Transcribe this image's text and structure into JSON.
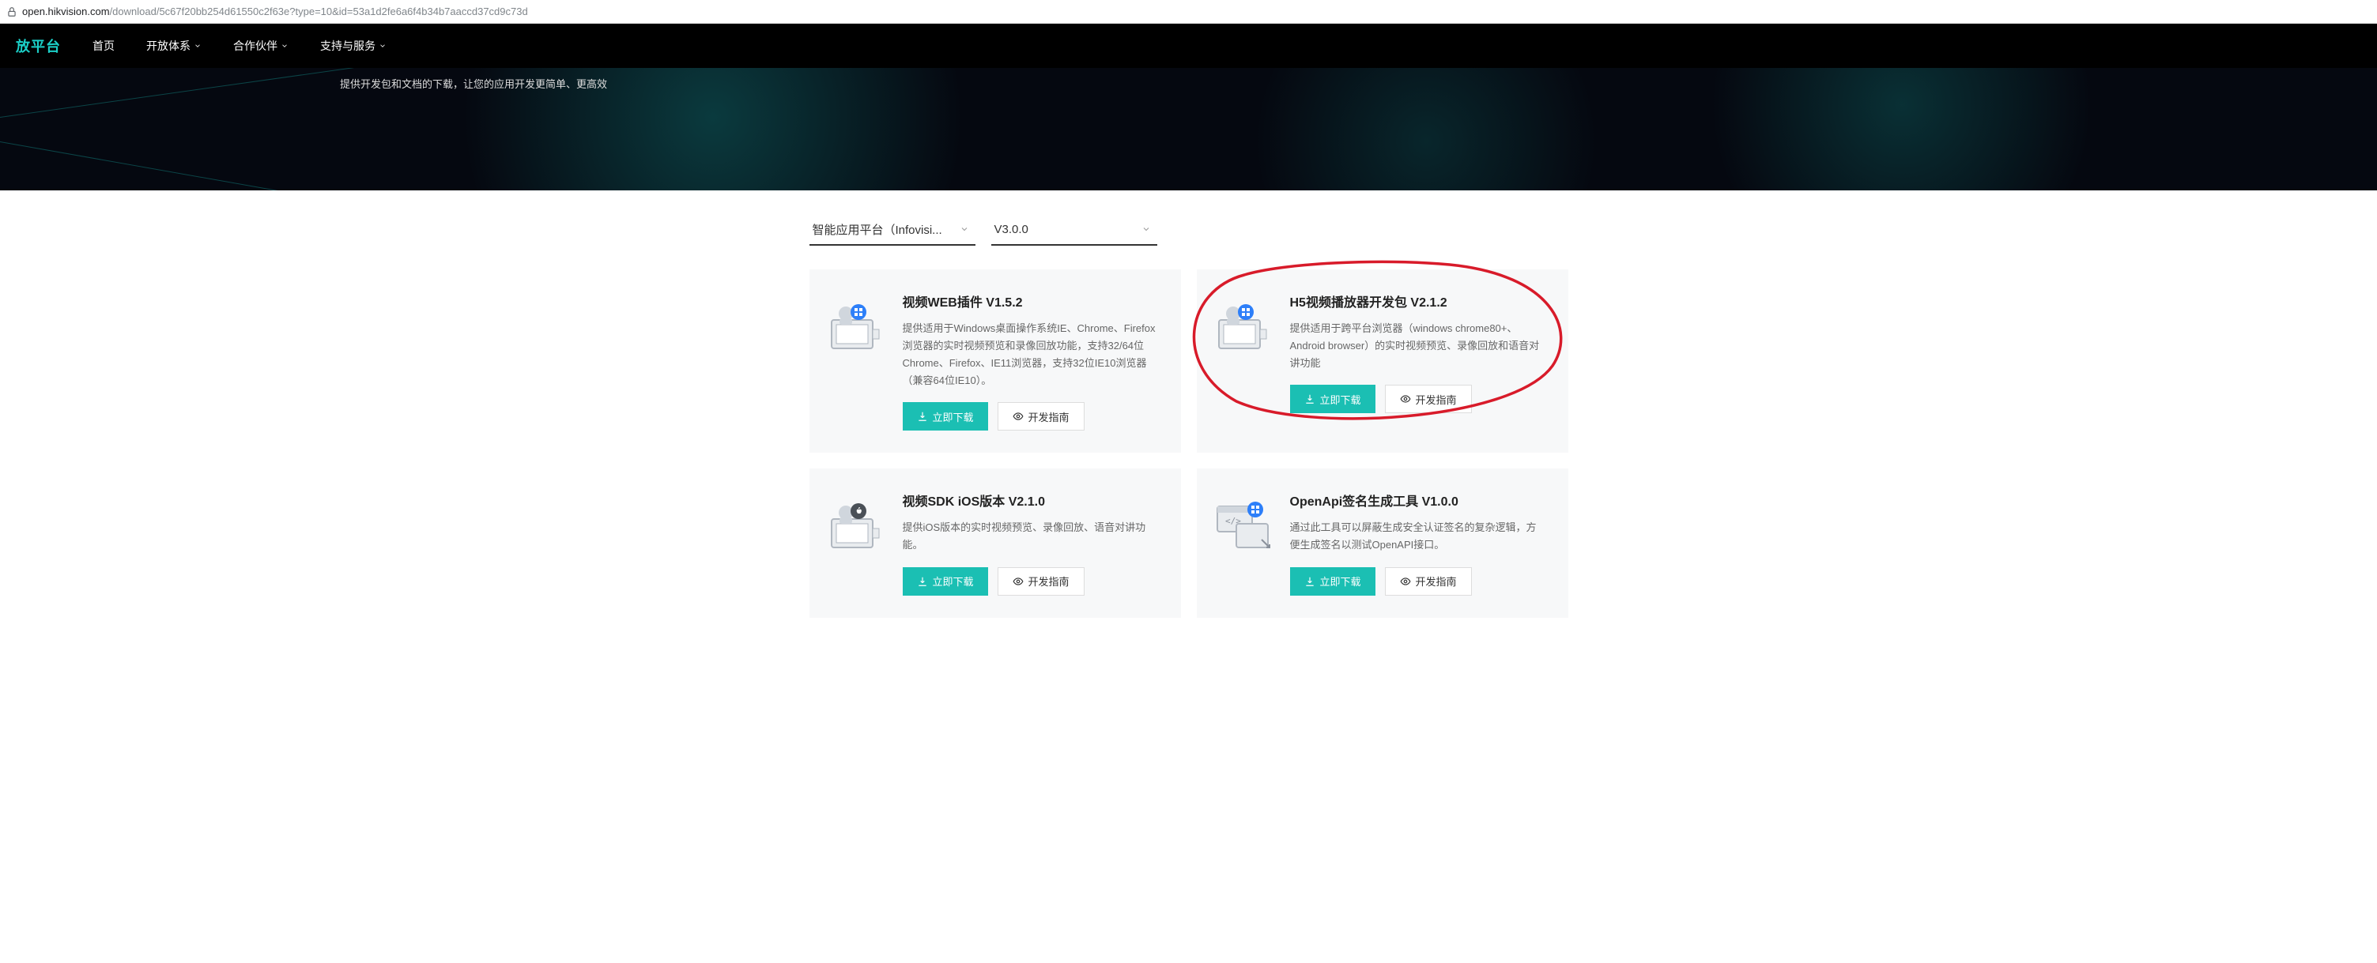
{
  "url": {
    "host": "open.hikvision.com",
    "path": "/download/5c67f20bb254d61550c2f63e?type=10&id=53a1d2fe6a6f4b34b7aaccd37cd9c73d"
  },
  "logo": "放平台",
  "nav": [
    {
      "label": "首页",
      "chev": false
    },
    {
      "label": "开放体系",
      "chev": true
    },
    {
      "label": "合作伙伴",
      "chev": true
    },
    {
      "label": "支持与服务",
      "chev": true
    }
  ],
  "hero": {
    "subtitle": "提供开发包和文档的下载，让您的应用开发更简单、更高效"
  },
  "filters": {
    "platform": "智能应用平台（Infovisi...",
    "version": "V3.0.0"
  },
  "buttons": {
    "download": "立即下载",
    "guide": "开发指南"
  },
  "cards": [
    {
      "title": "视频WEB插件 V1.5.2",
      "desc": "提供适用于Windows桌面操作系统IE、Chrome、Firefox浏览器的实时视频预览和录像回放功能，支持32/64位Chrome、Firefox、IE11浏览器，支持32位IE10浏览器（兼容64位IE10）。",
      "badge": "win"
    },
    {
      "title": "H5视频播放器开发包 V2.1.2",
      "desc": "提供适用于跨平台浏览器（windows chrome80+、Android browser）的实时视频预览、录像回放和语音对讲功能",
      "badge": "win"
    },
    {
      "title": "视频SDK iOS版本 V2.1.0",
      "desc": "提供iOS版本的实时视频预览、录像回放、语音对讲功能。",
      "badge": "apple"
    },
    {
      "title": "OpenApi签名生成工具 V1.0.0",
      "desc": "通过此工具可以屏蔽生成安全认证签名的复杂逻辑，方便生成签名以测试OpenAPI接口。",
      "badge": "win"
    }
  ]
}
